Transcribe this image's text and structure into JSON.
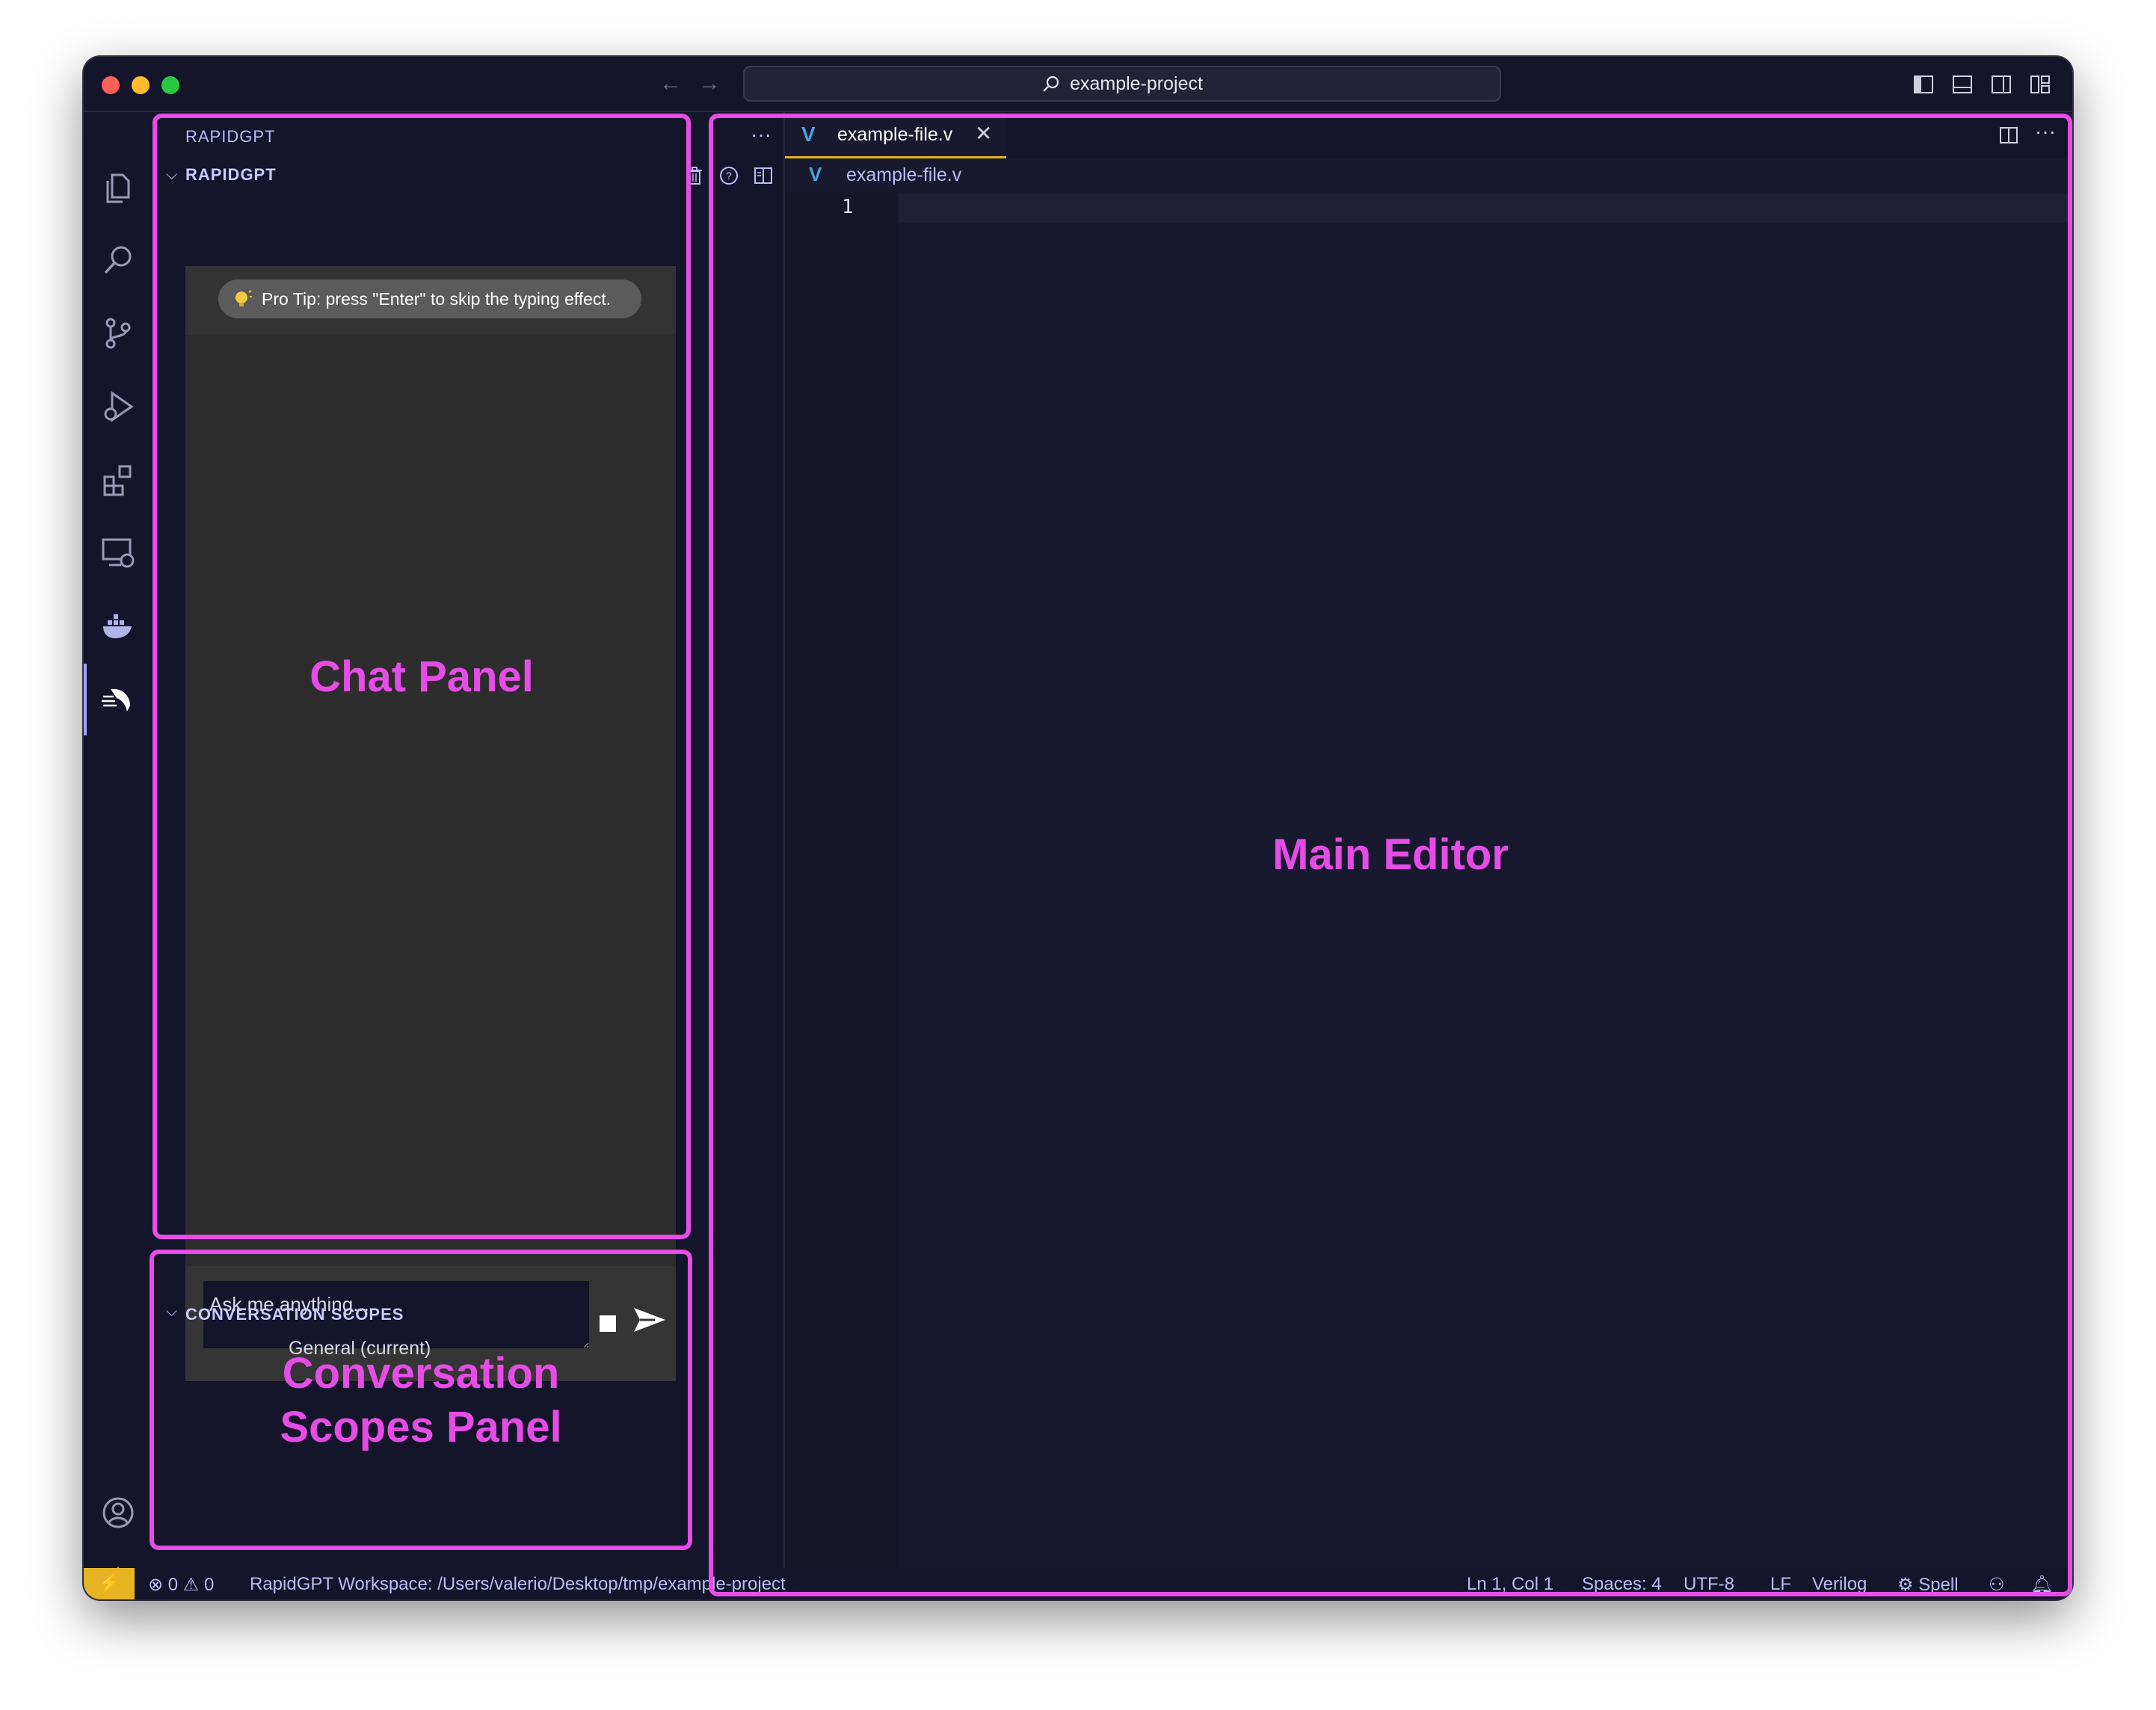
{
  "window": {
    "search_title": "example-project"
  },
  "sidebar": {
    "title": "RAPIDGPT",
    "more": "···",
    "section_name": "RAPIDGPT",
    "pro_tip": "Pro Tip: press \"Enter\" to skip the typing effect.",
    "chat_placeholder": "Ask me anything...",
    "scopes_title": "CONVERSATION SCOPES",
    "scopes": [
      {
        "label": "General (current)"
      }
    ]
  },
  "editor": {
    "tab_label": "example-file.v",
    "tab_icon_letter": "V",
    "breadcrumb": "example-file.v",
    "line_numbers": [
      "1"
    ],
    "more": "···"
  },
  "statusbar": {
    "remote": "⚡",
    "problems": "⊗ 0 ⚠ 0",
    "workspace": "RapidGPT Workspace: /Users/valerio/Desktop/tmp/example-project",
    "cursor": "Ln 1, Col 1",
    "spaces": "Spaces: 4",
    "encoding": "UTF-8",
    "eol": "LF",
    "language": "Verilog",
    "spell": "Spell"
  },
  "annotations": {
    "chat_panel": "Chat Panel",
    "scopes_panel_line1": "Conversation",
    "scopes_panel_line2": "Scopes Panel",
    "main_editor": "Main Editor"
  },
  "colors": {
    "annotation": "#e64ce6",
    "background": "#18182e",
    "accent_tab": "#e6b422",
    "verilog_icon": "#4aa0e0"
  }
}
